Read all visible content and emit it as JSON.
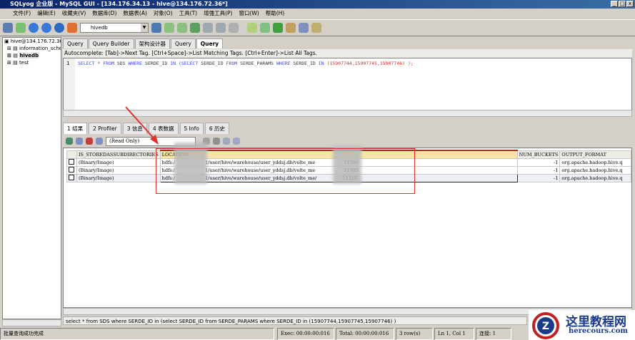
{
  "title": "SQLyog 企业版 - MySQL GUI - [134.176.34.13 - hive@134.176.72.36*]",
  "menu": [
    "文件(F)",
    "编辑(E)",
    "收藏夹(V)",
    "数据库(D)",
    "数据表(A)",
    "对象(O)",
    "工具(T)",
    "增强工具(P)",
    "窗口(W)",
    "帮助(H)"
  ],
  "toolbar": {
    "database": "hivedb"
  },
  "tree": {
    "connection": "hive@134.176.72.36",
    "items": [
      "information_schema",
      "hivedb",
      "test"
    ]
  },
  "query_tabs": [
    "Query",
    "Query Builder",
    "架构设计器",
    "Query",
    "Query"
  ],
  "autocomplete": "Autocomplete: [Tab]->Next Tag. [Ctrl+Space]->List Matching Tags. [Ctrl+Enter]->List All Tags.",
  "editor": {
    "line": "1",
    "kw1": "SELECT",
    "star": "*",
    "from": "FROM",
    "t1": "SDS",
    "where": "WHERE",
    "c1": "SERDE_ID",
    "in": "IN",
    "sel2": "(SELECT",
    "c2": "SERDE_ID",
    "from2": "FROM",
    "t2": "SERDE_PARAMS",
    "where2": "WHERE",
    "c3": "SERDE_ID",
    "in2": "IN",
    "nums": "(15907744,15907745,15907746)",
    "end": ");"
  },
  "result_tabs": [
    "1 结果",
    "2 Profiler",
    "3 信息",
    "4 表数据",
    "5 Info",
    "6 历史"
  ],
  "result_mode": "(Read Only)",
  "grid": {
    "columns": [
      "IS_STOREDASSUBDIRECTORIES",
      "LOCATION",
      "NUM_BUCKETS",
      "OUTPUT_FORMAT"
    ],
    "rows": [
      {
        "c0": "(Binary/Image)",
        "loc_a": "hdfs:/",
        "loc_b": "1/user/hive/warehouse/user_yddsj.db/volte_me",
        "loc_c": "11300",
        "c2": "-1",
        "c3": "org.apache.hadoop.hive.q"
      },
      {
        "c0": "(Binary/Image)",
        "loc_a": "hdfs:/",
        "loc_b": "1/user/hive/warehouse/user_yddsj.db/volte_me",
        "loc_c": "11305",
        "c2": "-1",
        "c3": "org.apache.hadoop.hive.q"
      },
      {
        "c0": "(Binary/Image)",
        "loc_a": "hdfs:/",
        "loc_b": "1/user/hive/warehouse/user_yddsj.db/volte_me/",
        "loc_c": "11310",
        "c2": "-1",
        "c3": "org.apache.hadoop.hive.q"
      }
    ]
  },
  "query_status": "select * from SDS where SERDE_ID in (select SERDE_ID from SERDE_PARAMS where SERDE_ID in (15907744,15907745,15907746) )",
  "status": {
    "message": "批量查询成功完成",
    "exec": "Exec: 00:00:00:016",
    "total": "Total: 00:00:00:016",
    "rows": "3 row(s)",
    "pos": "Ln 1, Col 1",
    "conn": "连接: 1"
  },
  "watermark": {
    "name": "这里教程网",
    "url": "herecours.com"
  },
  "colors": {
    "annotation": "#e03030",
    "title": "#0a246a"
  }
}
